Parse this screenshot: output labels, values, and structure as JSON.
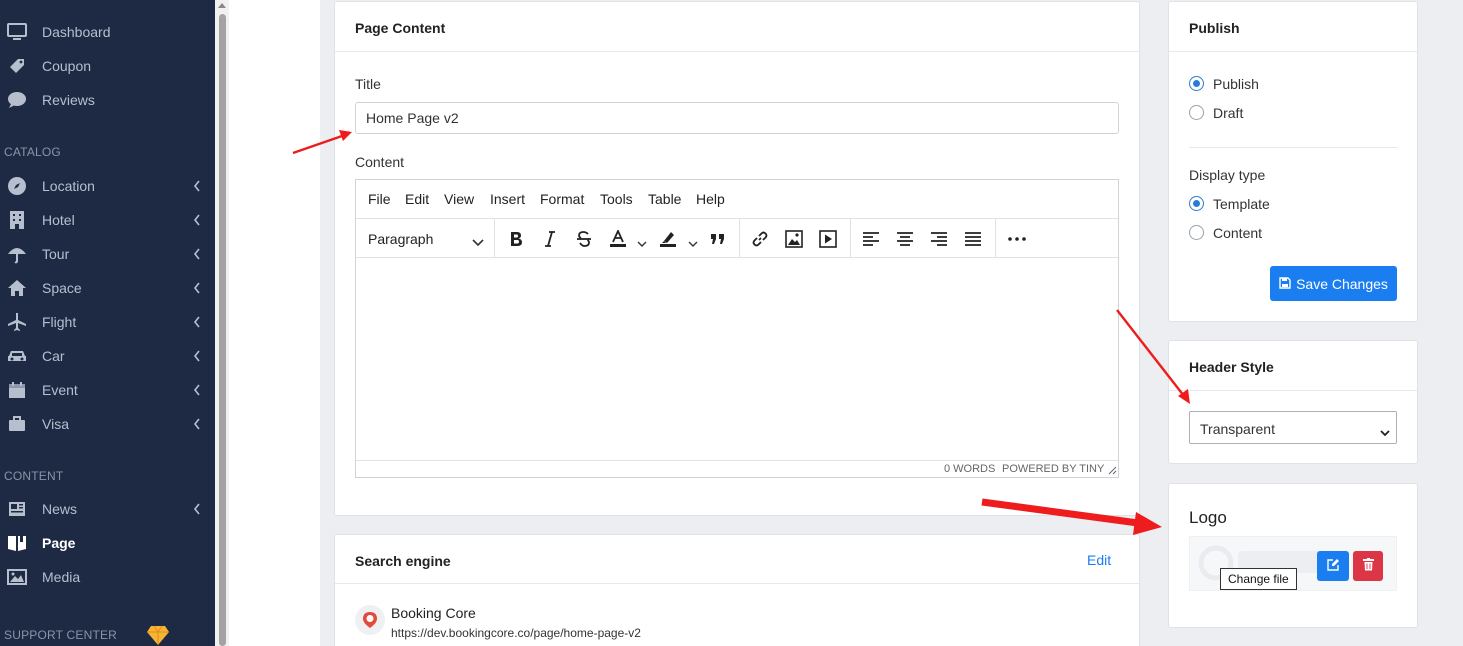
{
  "sidebar": {
    "items_top": [
      {
        "label": "Dashboard",
        "icon": "monitor-icon"
      },
      {
        "label": "Coupon",
        "icon": "ticket-icon"
      },
      {
        "label": "Reviews",
        "icon": "comment-icon"
      }
    ],
    "section_catalog": "CATALOG",
    "items_catalog": [
      {
        "label": "Location",
        "icon": "compass-icon"
      },
      {
        "label": "Hotel",
        "icon": "building-icon"
      },
      {
        "label": "Tour",
        "icon": "umbrella-icon"
      },
      {
        "label": "Space",
        "icon": "home-icon"
      },
      {
        "label": "Flight",
        "icon": "plane-icon"
      },
      {
        "label": "Car",
        "icon": "car-icon"
      },
      {
        "label": "Event",
        "icon": "calendar-icon"
      },
      {
        "label": "Visa",
        "icon": "briefcase-icon"
      }
    ],
    "section_content": "CONTENT",
    "items_content": [
      {
        "label": "News",
        "icon": "newspaper-icon"
      },
      {
        "label": "Page",
        "icon": "book-icon"
      },
      {
        "label": "Media",
        "icon": "image-icon"
      }
    ],
    "section_support": "SUPPORT CENTER"
  },
  "page_content": {
    "title": "Page Content",
    "title_label": "Title",
    "title_value": "Home Page v2",
    "content_label": "Content",
    "menu": [
      "File",
      "Edit",
      "View",
      "Insert",
      "Format",
      "Tools",
      "Table",
      "Help"
    ],
    "block_format": "Paragraph",
    "word_count": "0 WORDS",
    "powered_by": "POWERED BY TINY"
  },
  "search_engine": {
    "title": "Search engine",
    "edit_label": "Edit",
    "site_name": "Booking Core",
    "url": "https://dev.bookingcore.co/page/home-page-v2"
  },
  "publish": {
    "title": "Publish",
    "options": [
      "Publish",
      "Draft"
    ],
    "selected": "Publish",
    "display_type_label": "Display type",
    "display_options": [
      "Template",
      "Content"
    ],
    "display_selected": "Template",
    "save_label": "Save Changes"
  },
  "header_style": {
    "title": "Header Style",
    "selected": "Transparent"
  },
  "logo": {
    "title": "Logo",
    "tooltip": "Change file"
  },
  "colors": {
    "sidebar_bg": "#1e2a44",
    "accent": "#1a7ef0",
    "danger": "#dc3545",
    "annotation_arrow": "#ee1c1c"
  }
}
